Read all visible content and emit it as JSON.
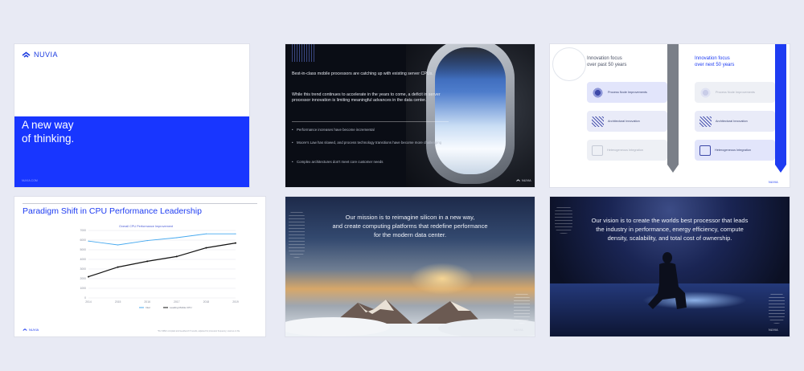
{
  "brand": "NUVIA",
  "slide1": {
    "logo_text": "NUVIA",
    "title_line1": "A new way",
    "title_line2": "of thinking.",
    "footer": "NUVIA.COM"
  },
  "slide2": {
    "para1": "Best-in-class mobile processors are catching up with existing server CPUs.",
    "para2": "While this trend continues to accelerate in the years to come, a deficit in server processor innovation is limiting meaningful advances in the data center.",
    "bullets": [
      "Performance increases have become incremental",
      "Moore's Law has slowed, and process technology transitions have become more challenging",
      "Complex architectures don't meet core customer needs"
    ],
    "logo": "NUVIA"
  },
  "slide3": {
    "left_title_1": "Innovation focus",
    "left_title_2": "over past 50 years",
    "right_title_1": "Innovation focus",
    "right_title_2": "over next 50 years",
    "left_items": [
      "Process Node Improvements",
      "Architectural Innovation",
      "Heterogeneous Integration"
    ],
    "right_items": [
      "Process Node Improvements",
      "Architectural Innovation",
      "Heterogeneous Integration"
    ],
    "logo": "NUVIA",
    "colors": {
      "accent": "#1e3cf2",
      "grey_bar": "#7a7f88"
    }
  },
  "slide4": {
    "title": "Paradigm Shift in CPU Performance Leadership",
    "logo": "NUVIA",
    "footnote": "*Per SPEC compiled and Geekbench 5 results, adjusted for processor frequency; sources on file",
    "chart_data": {
      "type": "line",
      "title": "Overall CPU Performance Improvement",
      "x": [
        "2014",
        "2015",
        "2016",
        "2017",
        "2018",
        "2019"
      ],
      "yticks": [
        "0",
        "1000",
        "2000",
        "3000",
        "4000",
        "5000",
        "6000",
        "7000"
      ],
      "ylim": [
        0,
        7000
      ],
      "series": [
        {
          "name": "Intel",
          "color": "#47a9ef",
          "values": [
            5900,
            5500,
            5950,
            6250,
            6650,
            6650
          ]
        },
        {
          "name": "Leading Mobile CPU",
          "color": "#111111",
          "values": [
            2200,
            3200,
            3800,
            4300,
            5200,
            5700
          ]
        }
      ],
      "legend": "bottom"
    }
  },
  "slide5": {
    "quote_1": "Our mission is to reimagine silicon in a new way,",
    "quote_2": "and create computing platforms that redefine performance",
    "quote_3": "for the modern data center.",
    "logo": "NUVIA"
  },
  "slide6": {
    "quote_1": "Our vision is to create the worlds best processor that leads",
    "quote_2": "the industry in performance, energy efficiency, compute",
    "quote_3": "density, scalability, and total cost of ownership.",
    "logo": "NUVIA"
  }
}
